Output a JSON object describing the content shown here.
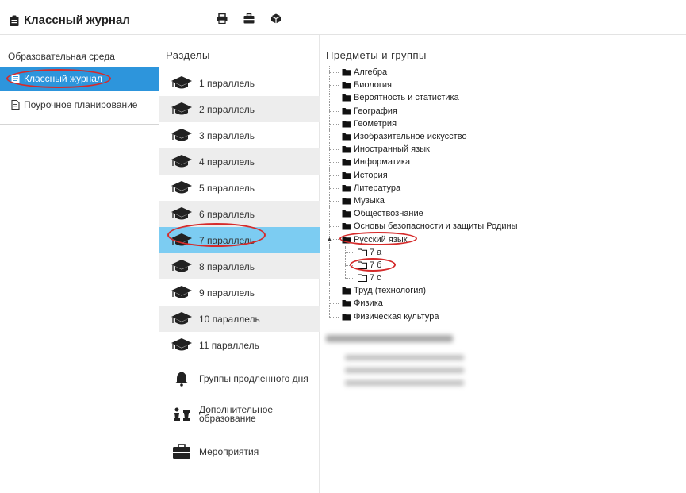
{
  "header": {
    "title": "Классный журнал",
    "title_icon": "clipboard-icon",
    "toolbar_icons": [
      "print-icon",
      "briefcase-icon",
      "cube-icon"
    ]
  },
  "leftnav": {
    "items": [
      {
        "label": "Образовательная среда"
      },
      {
        "label": "Классный журнал",
        "icon": "notebook-icon",
        "active": true
      },
      {
        "label": "Поурочное планирование",
        "icon": "document-icon"
      }
    ]
  },
  "sections": {
    "heading": "Разделы",
    "items": [
      {
        "label": "1 параллель",
        "icon": "graduation-cap-icon"
      },
      {
        "label": "2 параллель",
        "icon": "graduation-cap-icon"
      },
      {
        "label": "3 параллель",
        "icon": "graduation-cap-icon"
      },
      {
        "label": "4 параллель",
        "icon": "graduation-cap-icon"
      },
      {
        "label": "5 параллель",
        "icon": "graduation-cap-icon"
      },
      {
        "label": "6 параллель",
        "icon": "graduation-cap-icon"
      },
      {
        "label": "7 параллель",
        "icon": "graduation-cap-icon",
        "active": true
      },
      {
        "label": "8 параллель",
        "icon": "graduation-cap-icon"
      },
      {
        "label": "9 параллель",
        "icon": "graduation-cap-icon"
      },
      {
        "label": "10 параллель",
        "icon": "graduation-cap-icon"
      },
      {
        "label": "11 параллель",
        "icon": "graduation-cap-icon"
      },
      {
        "label": "Группы продленного дня",
        "icon": "bell-icon"
      },
      {
        "label_line1": "Дополнительное",
        "label_line2": "образование",
        "icon": "chess-icon"
      },
      {
        "label": "Мероприятия",
        "icon": "briefcase-icon"
      }
    ]
  },
  "tree": {
    "heading": "Предметы и группы",
    "subjects": [
      "Алгебра",
      "Биология",
      "Вероятность и статистика",
      "География",
      "Геометрия",
      "Изобразительное искусство",
      "Иностранный язык",
      "Информатика",
      "История",
      "Литература",
      "Музыка",
      "Обществознание",
      "Основы безопасности и защиты Родины",
      "Русский язык",
      "Труд (технология)",
      "Физика",
      "Физическая культура"
    ],
    "expanded_subject": "Русский язык",
    "groups": [
      "7 а",
      "7 б",
      "7 с"
    ],
    "selected_group": "7 б"
  },
  "colors": {
    "nav_active": "#2d95dc",
    "section_active": "#7cccf2",
    "section_alt": "#ededed",
    "annotation": "#d52b2b"
  }
}
